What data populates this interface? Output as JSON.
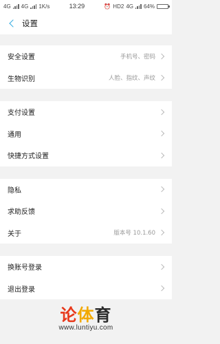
{
  "status_bar": {
    "network1": "4G",
    "network2": "4G",
    "speed": "1K/s",
    "time": "13:29",
    "hd": "HD2",
    "net_right": "4G",
    "battery": "64%",
    "battery_level": 0.64
  },
  "header": {
    "title": "设置"
  },
  "groups": [
    {
      "rows": [
        {
          "label": "安全设置",
          "value": "手机号、密码"
        },
        {
          "label": "生物识别",
          "value": "人脸、指纹、声纹"
        }
      ]
    },
    {
      "rows": [
        {
          "label": "支付设置",
          "value": ""
        },
        {
          "label": "通用",
          "value": ""
        },
        {
          "label": "快捷方式设置",
          "value": ""
        }
      ]
    },
    {
      "rows": [
        {
          "label": "隐私",
          "value": ""
        },
        {
          "label": "求助反馈",
          "value": ""
        },
        {
          "label": "关于",
          "value": "版本号 10.1.60"
        }
      ]
    },
    {
      "rows": [
        {
          "label": "换账号登录",
          "value": ""
        },
        {
          "label": "退出登录",
          "value": ""
        }
      ]
    }
  ],
  "watermark": {
    "logo_part1": "论",
    "logo_part2": "体",
    "logo_part3": "育",
    "url": "www.luntiyu.com"
  }
}
